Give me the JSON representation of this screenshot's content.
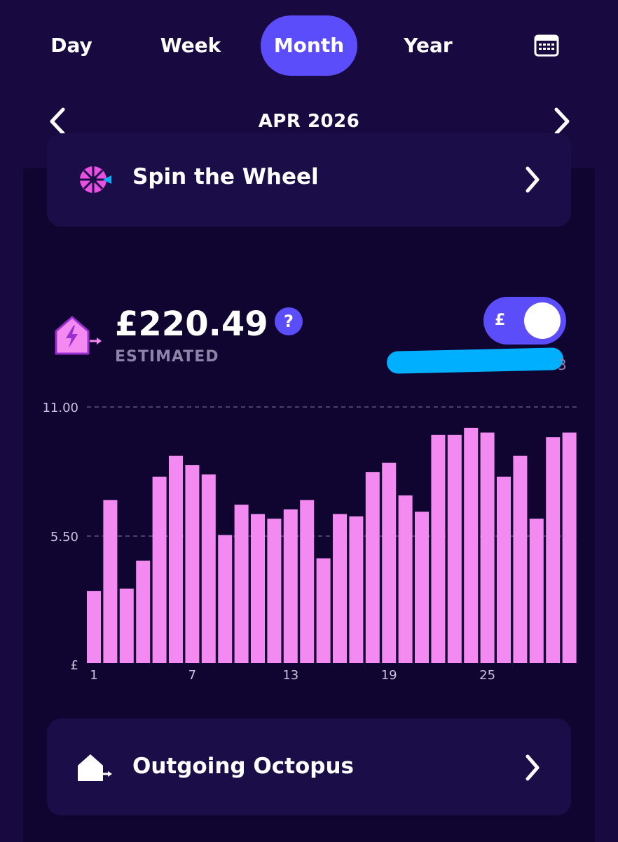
{
  "period_tabs": {
    "day": "Day",
    "week": "Week",
    "month": "Month",
    "year": "Year",
    "active": "Month",
    "calendar_icon": "calendar-icon"
  },
  "period_nav": {
    "label": "APR 2026",
    "prev_icon": "chevron-left-icon",
    "next_icon": "chevron-right-icon"
  },
  "spin_card": {
    "label": "Spin the Wheel",
    "icon": "wheel-icon"
  },
  "summary": {
    "amount": "£220.49",
    "status": "ESTIMATED",
    "help_symbol": "?",
    "toggle_symbol": "£",
    "toggle_on": true,
    "redacted_tail": "3",
    "icon": "house-export-icon"
  },
  "chart_data": {
    "type": "bar",
    "y_ticks": [
      "11.00",
      "5.50"
    ],
    "y_unit_label": "£",
    "ylim": [
      0,
      11
    ],
    "x_tick_labels": [
      "1",
      "7",
      "13",
      "19",
      "25"
    ],
    "x": [
      1,
      2,
      3,
      4,
      5,
      6,
      7,
      8,
      9,
      10,
      11,
      12,
      13,
      14,
      15,
      16,
      17,
      18,
      19,
      20,
      21,
      22,
      23,
      24,
      25,
      26,
      27,
      28,
      29,
      30
    ],
    "values": [
      3.1,
      7.0,
      3.2,
      4.4,
      8.0,
      8.9,
      8.5,
      8.1,
      5.5,
      6.8,
      6.4,
      6.2,
      6.6,
      7.0,
      4.5,
      6.4,
      6.3,
      8.2,
      8.6,
      7.2,
      6.5,
      9.8,
      9.8,
      10.1,
      9.9,
      8.0,
      8.9,
      6.2,
      9.7,
      9.9
    ],
    "bar_color": "#f28af2",
    "gridlines": "dashed"
  },
  "outgoing_card": {
    "label": "Outgoing Octopus",
    "icon": "house-export-icon"
  },
  "colors": {
    "background": "#180a40",
    "panel": "#0f0530",
    "card": "#1b0d48",
    "accent": "#5c4dfb",
    "bar": "#f28af2",
    "redaction": "#00b0ff"
  }
}
